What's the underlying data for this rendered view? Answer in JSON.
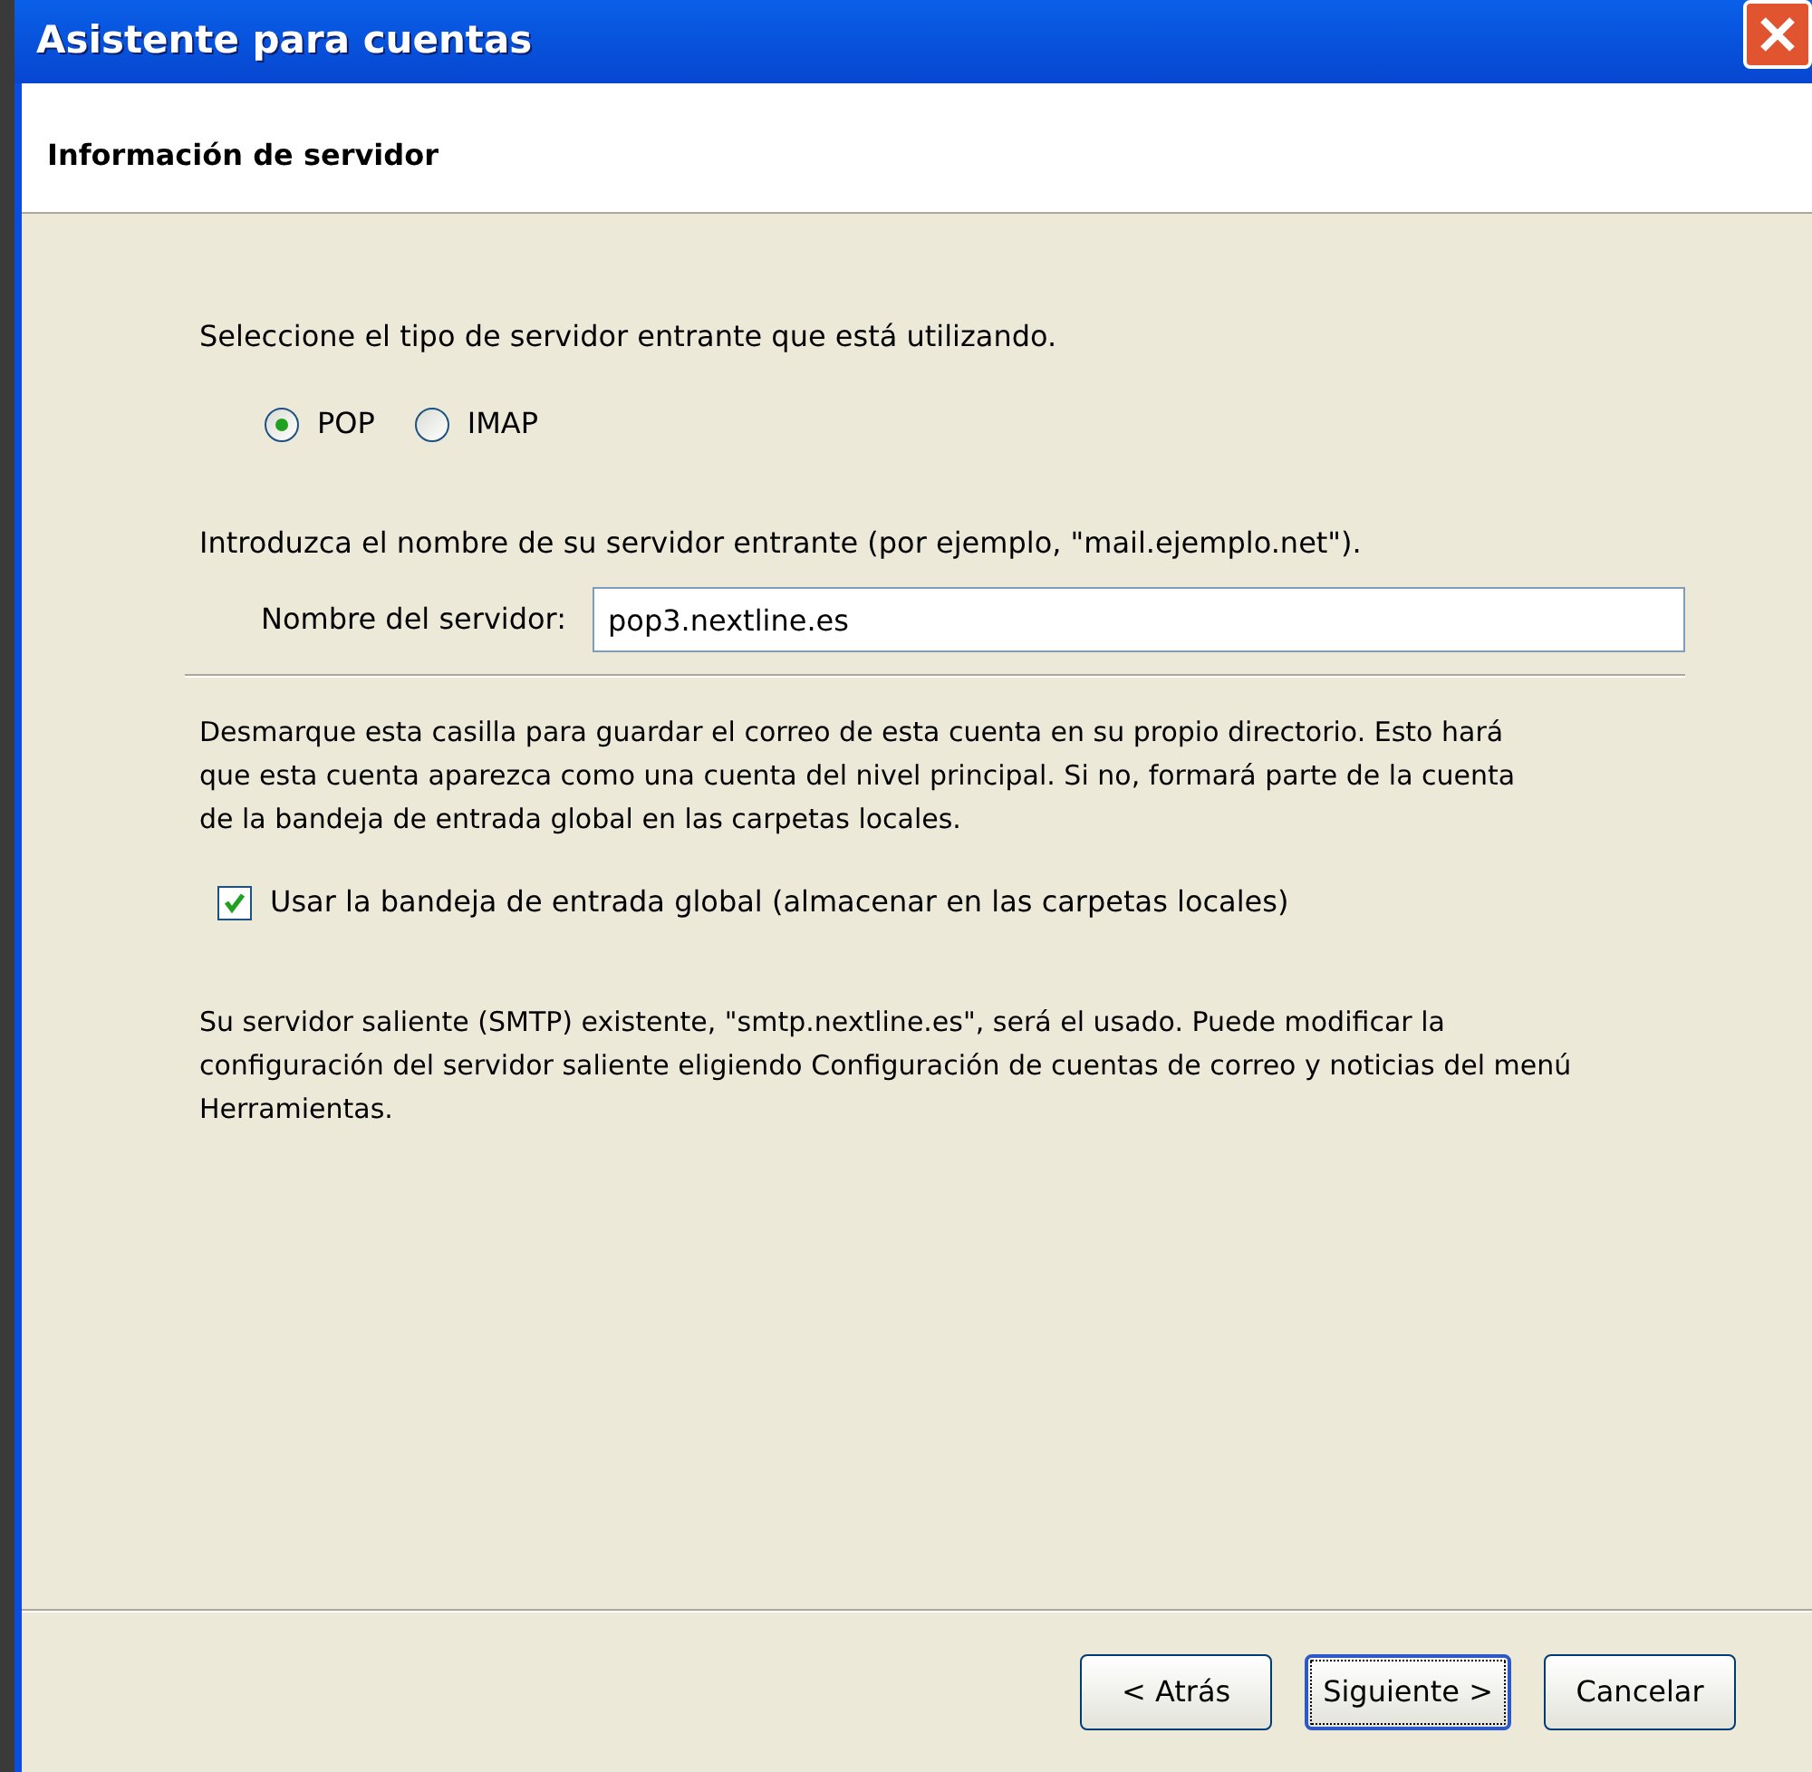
{
  "window": {
    "title": "Asistente para cuentas"
  },
  "header": {
    "title": "Información de servidor"
  },
  "server_type": {
    "prompt": "Seleccione el tipo de servidor entrante que está utilizando.",
    "options": [
      {
        "label": "POP",
        "selected": true
      },
      {
        "label": "IMAP",
        "selected": false
      }
    ]
  },
  "server_name": {
    "instructions": "Introduzca el nombre de su servidor entrante (por ejemplo, \"mail.ejemplo.net\").",
    "label": "Nombre del servidor:",
    "value": "pop3.nextline.es"
  },
  "global_inbox": {
    "description": "Desmarque esta casilla para guardar el correo de esta cuenta en su propio directorio. Esto hará que esta cuenta aparezca como una cuenta del nivel principal. Si no, formará parte de la cuenta de la bandeja de entrada global en las carpetas locales.",
    "label": "Usar la bandeja de entrada global (almacenar en las carpetas locales)",
    "checked": true
  },
  "smtp_note": "Su servidor saliente (SMTP) existente, \"smtp.nextline.es\", será el usado. Puede modificar la configuración del servidor saliente eligiendo Configuración de cuentas de correo y noticias del menú Herramientas.",
  "buttons": [
    {
      "label": "< Atrás",
      "focused": false
    },
    {
      "label": "Siguiente >",
      "focused": true
    },
    {
      "label": "Cancelar",
      "focused": false
    }
  ]
}
